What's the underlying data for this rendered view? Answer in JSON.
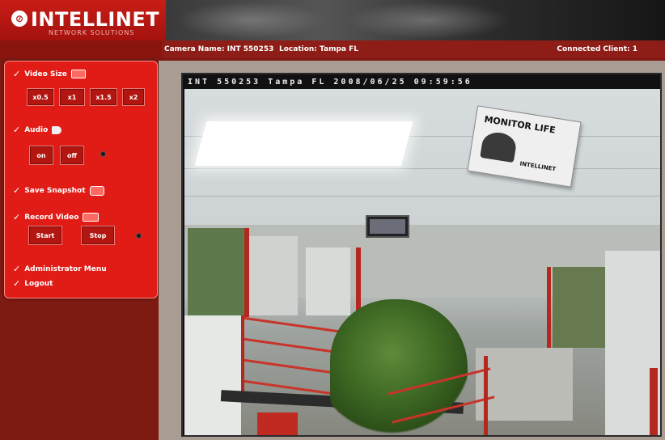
{
  "brand": {
    "name": "INTELLINET",
    "tagline": "NETWORK SOLUTIONS",
    "mark": "⊘"
  },
  "infobar": {
    "camera_name": "Camera Name: INT 550253",
    "location": "Location: Tampa FL",
    "connected": "Connected Client: 1"
  },
  "panel": {
    "video_size": {
      "label": "Video Size",
      "buttons": [
        "x0.5",
        "x1",
        "x1.5",
        "x2"
      ]
    },
    "audio": {
      "label": "Audio",
      "buttons": [
        "on",
        "off"
      ]
    },
    "save_snapshot": {
      "label": "Save Snapshot"
    },
    "record_video": {
      "label": "Record Video",
      "buttons": [
        "Start",
        "Stop"
      ]
    },
    "admin_menu": {
      "label": "Administrator Menu"
    },
    "logout": {
      "label": "Logout"
    }
  },
  "camera": {
    "osd": "INT 550253  Tampa FL  2008/06/25 09:59:56",
    "sign_title": "MONITOR LIFE",
    "sign_brand": "INTELLINET"
  },
  "colors": {
    "brand_red": "#e11c17",
    "dark_red": "#7d1a12",
    "panel_border": "#ff8d86"
  },
  "icons": {
    "video_size": "monitor-icon",
    "audio": "speaker-icon",
    "snapshot": "camera-icon",
    "record": "video-camera-icon",
    "check": "check-icon"
  }
}
